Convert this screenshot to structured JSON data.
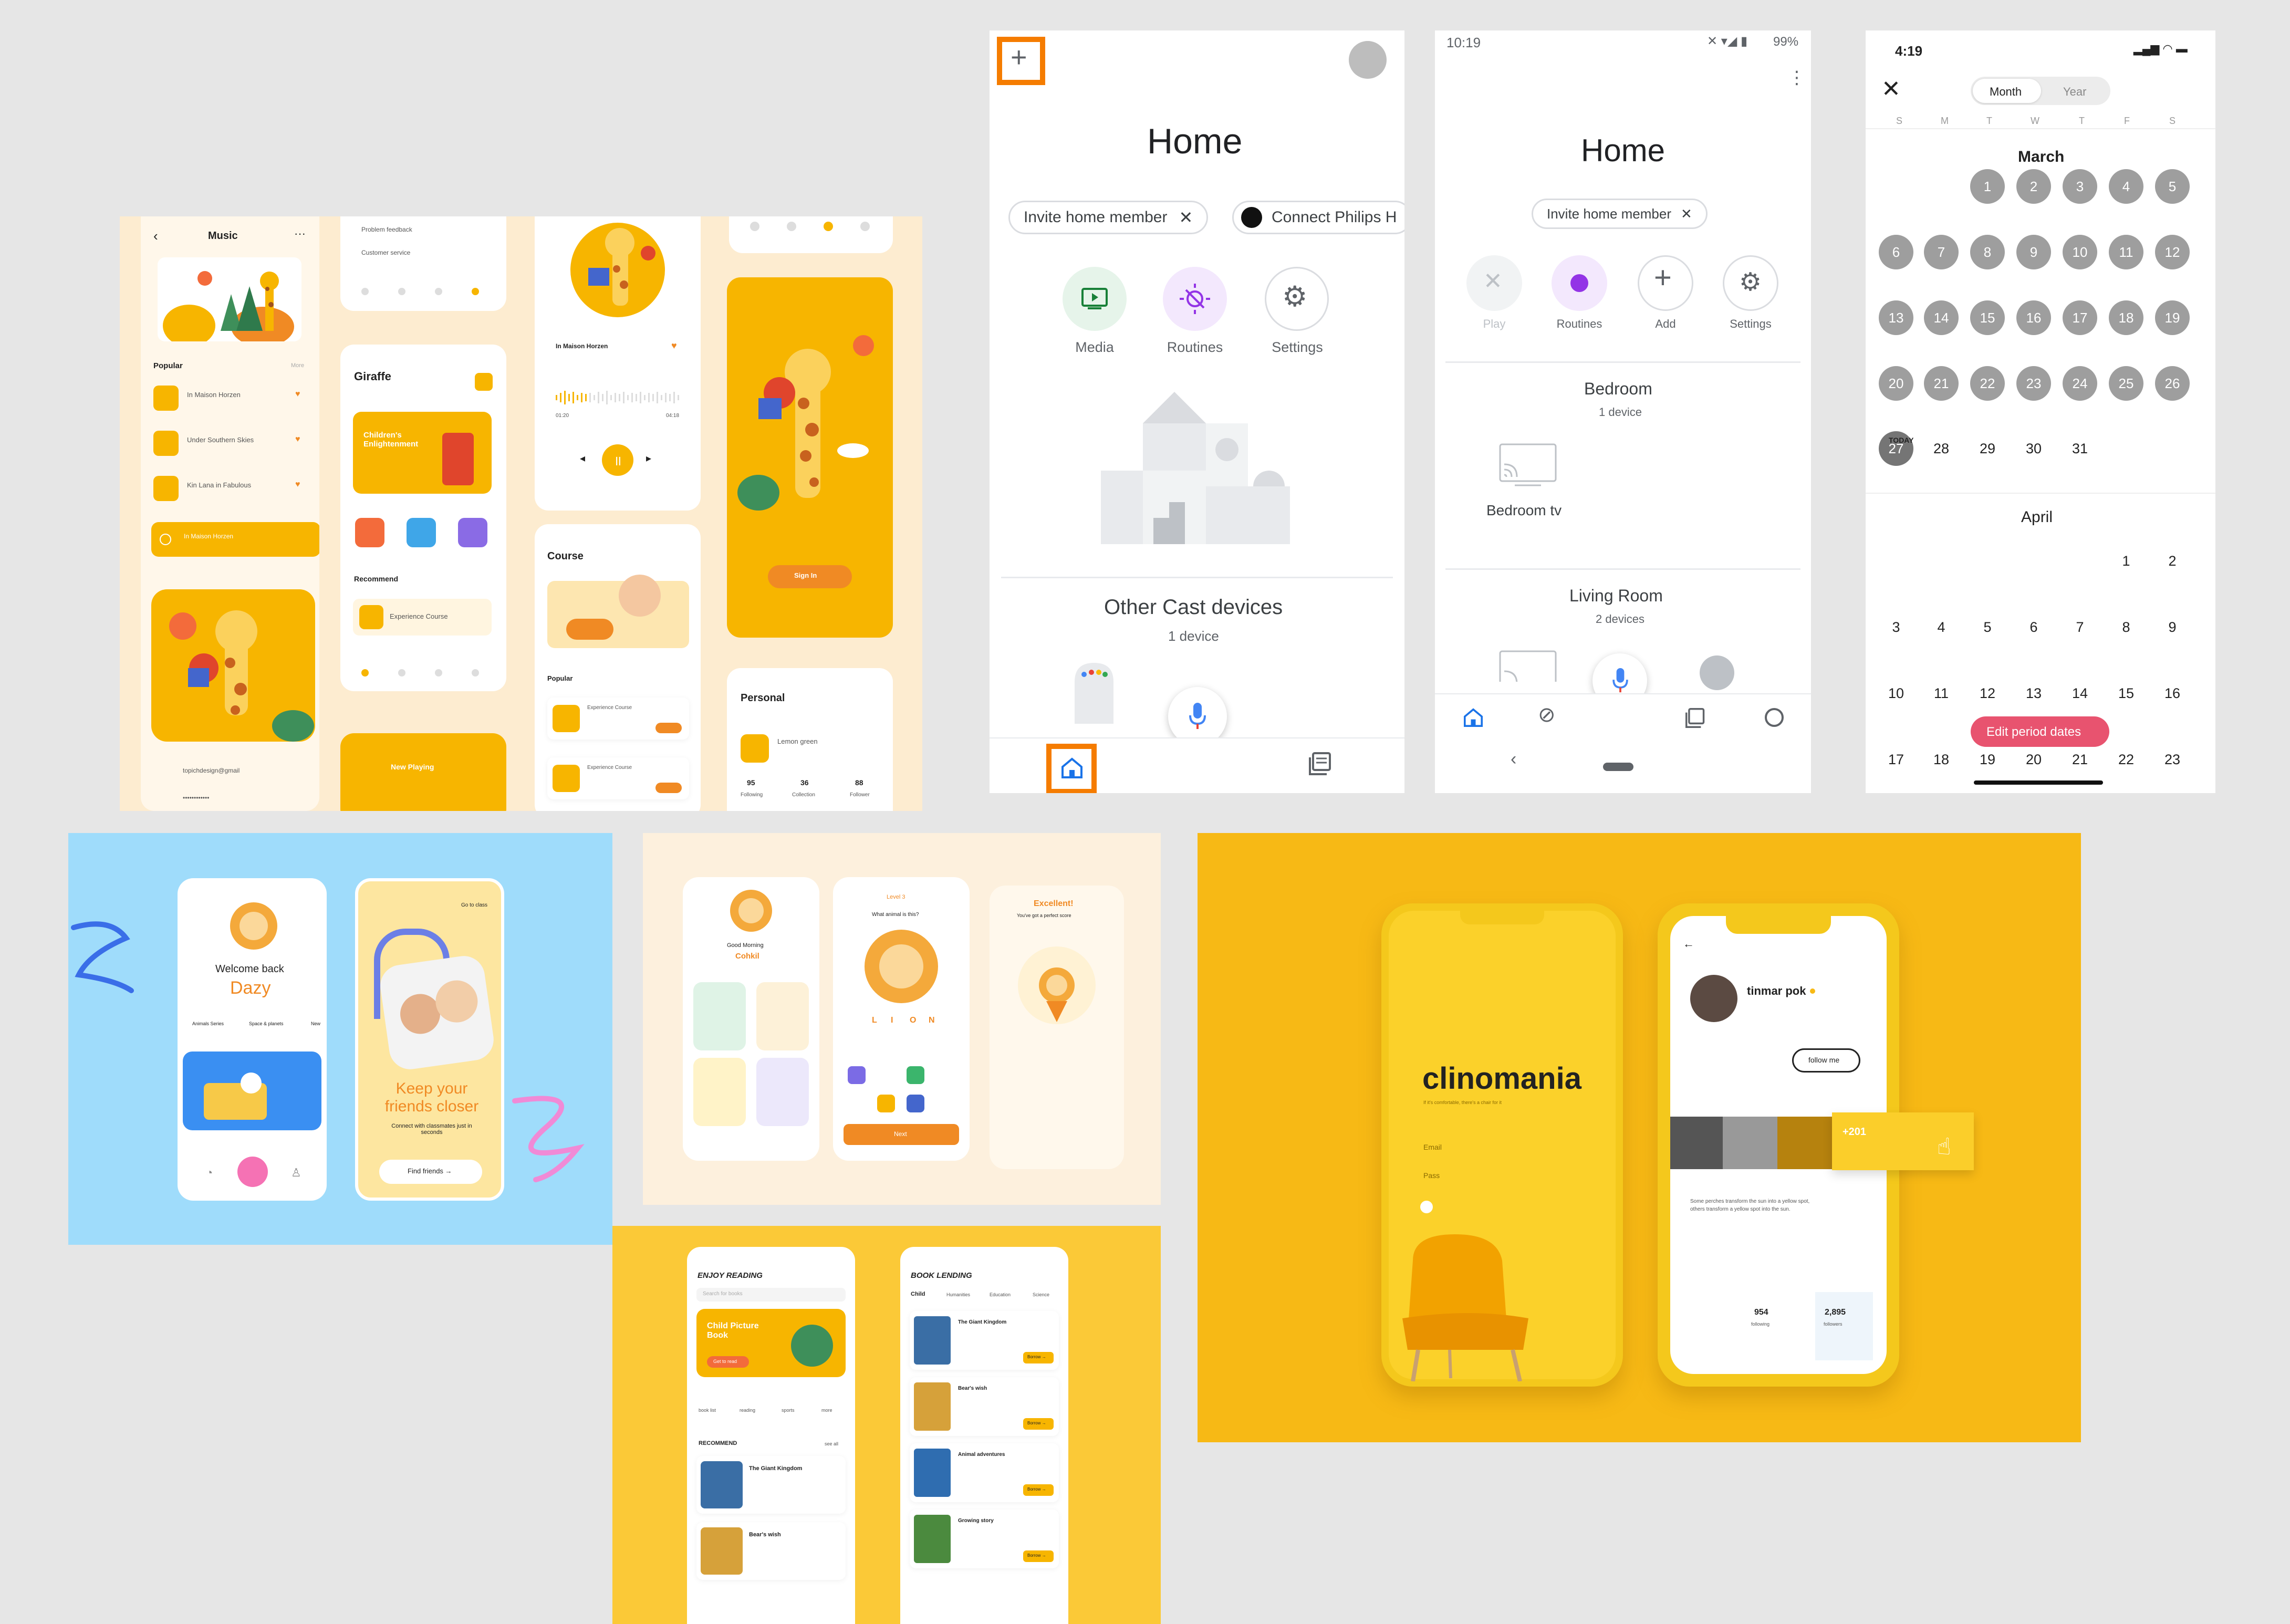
{
  "music": {
    "title": "Music",
    "menu_glyph": "···",
    "popular": "Popular",
    "more": "More",
    "songs": [
      "In Maison Horzen",
      "Under Southern Skies",
      "Kin Lana in Fabulous"
    ],
    "now_playing": "In Maison Horzen",
    "email": "topichdesign@gmail",
    "password": "••••••••••••",
    "feedback": "Problem feedback",
    "customer": "Customer service",
    "giraffe": "Giraffe",
    "enlight": "Children's Enlightenment",
    "recommend": "Recommend",
    "experience": "Experience Course",
    "nowplaying_bar": "New Playing",
    "player_title": "In Maison Horzen",
    "time_start": "01:20",
    "time_end": "04:18",
    "sign_in": "Sign In",
    "course": "Course",
    "course_popular": "Popular",
    "course_item": "Experience Course",
    "personal": "Personal",
    "personal_name": "Lemon green",
    "stat1": "95",
    "stat1_label": "Following",
    "stat2": "36",
    "stat2_label": "Collection",
    "stat3": "88",
    "stat3_label": "Follower"
  },
  "google_home_a": {
    "title": "Home",
    "chip1": "Invite home member",
    "chip2": "Connect Philips H",
    "btn_media": "Media",
    "btn_routines": "Routines",
    "btn_settings": "Settings",
    "section": "Other Cast devices",
    "section_count": "1 device",
    "accent_orange": "#f57c00"
  },
  "google_home_b": {
    "status_time": "10:19",
    "battery": "99%",
    "title": "Home",
    "chip": "Invite home member",
    "btn_play": "Play",
    "btn_routines": "Routines",
    "btn_add": "Add",
    "btn_settings": "Settings",
    "bedroom": "Bedroom",
    "bedroom_count": "1 device",
    "bedroom_tv": "Bedroom tv",
    "living": "Living Room",
    "living_count": "2 devices"
  },
  "calendar": {
    "status_time": "4:19",
    "tab_month": "Month",
    "tab_year": "Year",
    "weekdays": [
      "S",
      "M",
      "T",
      "W",
      "T",
      "F",
      "S"
    ],
    "march": "March",
    "today": "TODAY",
    "april": "April",
    "edit": "Edit period dates",
    "accent": "#e8536f"
  },
  "kids": {
    "welcome": "Welcome back",
    "name": "Dazy",
    "tabs": [
      "Animals Series",
      "Space & planets",
      "New"
    ],
    "skip": "Go to class",
    "keep": "Keep your friends closer",
    "sub": "Connect with classmates just in seconds",
    "find": "Find friends →"
  },
  "lion": {
    "greeting": "Good Morning",
    "name": "Cohkil",
    "level": "Level 3",
    "question": "What animal is this?",
    "letters": [
      "L",
      "I",
      "O",
      "N"
    ],
    "excellent": "Excellent!",
    "excellent_sub": "You've got a perfect score",
    "next": "Next"
  },
  "reading": {
    "title1": "ENJOY READING",
    "search": "Search for books",
    "banner": "Child Picture Book",
    "banner_btn": "Get to read",
    "cats": [
      "book list",
      "reading",
      "sports",
      "more"
    ],
    "recommend": "RECOMMEND",
    "see_all": "see all",
    "book1": "The Giant Kingdom",
    "book2": "Bear's wish",
    "title2": "BOOK LENDING",
    "tabs2": [
      "Child",
      "Humanities",
      "Education",
      "Science"
    ],
    "books2": [
      "The Giant Kingdom",
      "Bear's wish",
      "Animal adventures",
      "Growing story"
    ],
    "borrow": "Borrow →"
  },
  "clinomania": {
    "brand": "clinomania",
    "tagline": "If it's comfortable, there's a chair for it",
    "email": "Email",
    "pass": "Pass",
    "user": "tinmar pok",
    "follow": "follow me",
    "plus": "+201",
    "bio": "Some perches transform the sun into a yellow spot, others transform a yellow spot into the sun.",
    "s1": "954",
    "s1l": "following",
    "s2": "2,895",
    "s2l": "followers"
  }
}
